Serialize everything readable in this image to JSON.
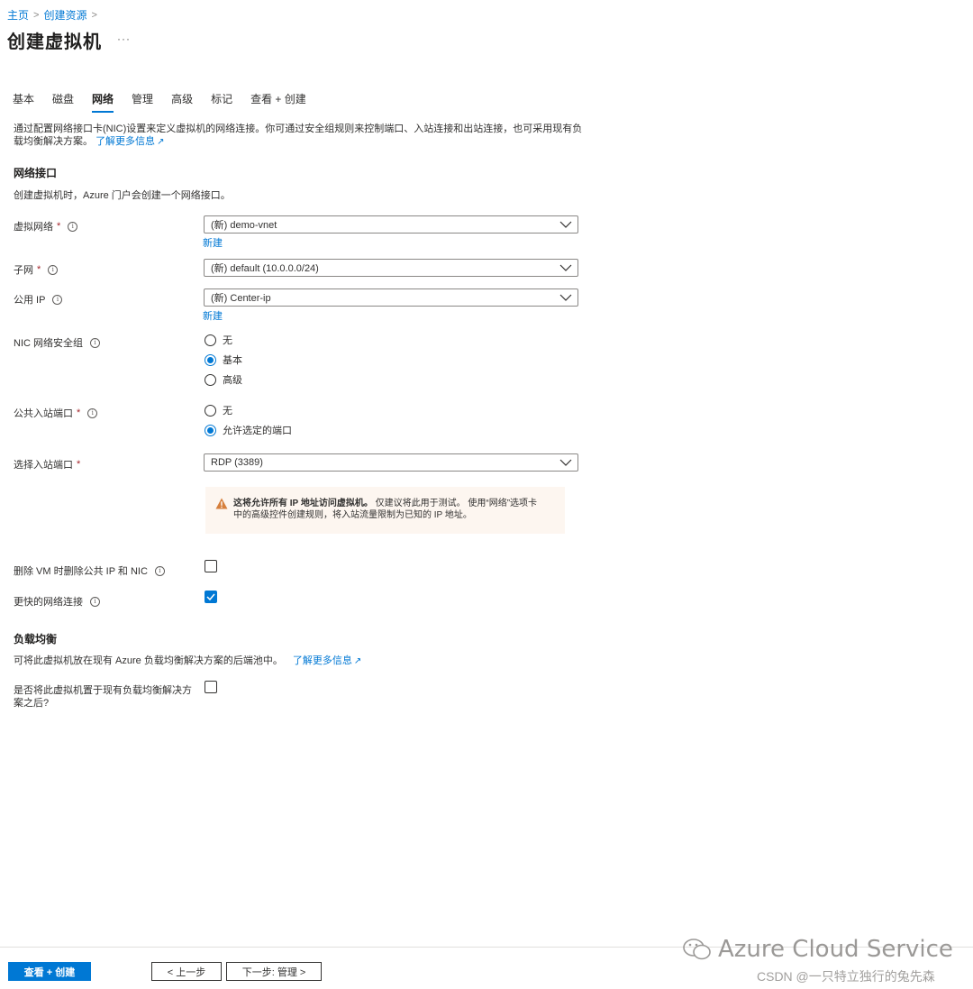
{
  "breadcrumb": {
    "home": "主页",
    "create_resource": "创建资源"
  },
  "page_title": "创建虚拟机",
  "more": "···",
  "tabs": [
    {
      "label": "基本",
      "active": false
    },
    {
      "label": "磁盘",
      "active": false
    },
    {
      "label": "网络",
      "active": true
    },
    {
      "label": "管理",
      "active": false
    },
    {
      "label": "高级",
      "active": false
    },
    {
      "label": "标记",
      "active": false
    },
    {
      "label": "查看 + 创建",
      "active": false
    }
  ],
  "intro": {
    "text": "通过配置网络接口卡(NIC)设置来定义虚拟机的网络连接。你可通过安全组规则来控制端口、入站连接和出站连接，也可采用现有负载均衡解决方案。",
    "link": "了解更多信息"
  },
  "network_interface": {
    "title": "网络接口",
    "desc": "创建虚拟机时，Azure 门户会创建一个网络接口。",
    "vnet": {
      "label": "虚拟网络",
      "required": "*",
      "value": "(新) demo-vnet",
      "new_link": "新建"
    },
    "subnet": {
      "label": "子网",
      "required": "*",
      "value": "(新) default (10.0.0.0/24)"
    },
    "public_ip": {
      "label": "公用 IP",
      "value": "(新) Center-ip",
      "new_link": "新建"
    },
    "nsg": {
      "label": "NIC 网络安全组",
      "options": [
        {
          "label": "无",
          "checked": false
        },
        {
          "label": "基本",
          "checked": true
        },
        {
          "label": "高级",
          "checked": false
        }
      ]
    },
    "inbound": {
      "label": "公共入站端口",
      "required": "*",
      "options": [
        {
          "label": "无",
          "checked": false
        },
        {
          "label": "允许选定的端口",
          "checked": true
        }
      ]
    },
    "select_ports": {
      "label": "选择入站端口",
      "required": "*",
      "value": "RDP (3389)"
    },
    "warning": {
      "bold": "这将允许所有 IP 地址访问虚拟机。",
      "text1": " 仅建议将此用于测试。 使用“网络”选项卡",
      "text2": "中的高级控件创建规则，将入站流量限制为已知的 IP 地址。"
    },
    "delete_with_vm": {
      "label": "删除 VM 时删除公共 IP 和 NIC",
      "checked": false
    },
    "accelerated": {
      "label": "更快的网络连接",
      "checked": true
    }
  },
  "load_balancing": {
    "title": "负载均衡",
    "desc": "可将此虚拟机放在现有 Azure 负载均衡解决方案的后端池中。",
    "link": "了解更多信息",
    "question_line1": "是否将此虚拟机置于现有负载均衡解决方",
    "question_line2": "案之后?",
    "checked": false
  },
  "footer": {
    "review_create": "查看 + 创建",
    "prev": "< 上一步",
    "next": "下一步: 管理 >"
  },
  "watermark": {
    "brand": "Azure Cloud Service",
    "credit": "CSDN @一只特立独行的兔先森"
  },
  "colors": {
    "accent": "#0078d4",
    "required": "#a4262c",
    "warning_bg": "#fdf6f0",
    "warning_icon": "#d67f3c"
  }
}
